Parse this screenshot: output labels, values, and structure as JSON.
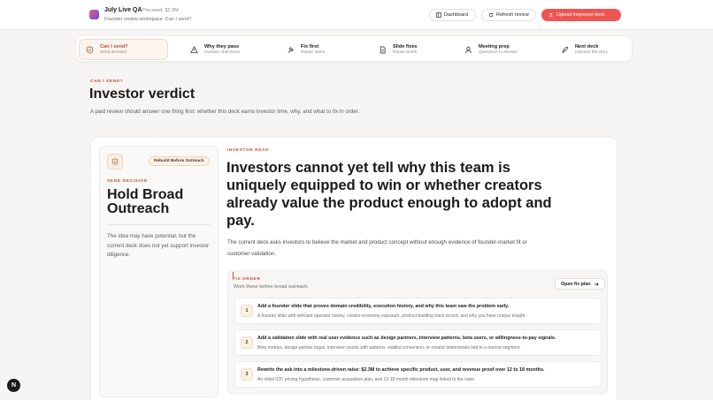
{
  "app": {
    "title": "July Live QA",
    "stage": "Pre-seed, $2.3M",
    "workspace": "Founder review workspace: Can I send?"
  },
  "actions": {
    "dashboard": "Dashboard",
    "refresh": "Refresh review",
    "upload": "Upload improved deck"
  },
  "steps": [
    {
      "label": "Can I send?",
      "sub": "Send decision",
      "icon": "shield-check-icon"
    },
    {
      "label": "Why they pass",
      "sub": "Investor objections",
      "icon": "warning-icon"
    },
    {
      "label": "Fix first",
      "sub": "Repair sprint",
      "icon": "hammer-icon"
    },
    {
      "label": "Slide fixes",
      "sub": "Repair briefs",
      "icon": "document-icon"
    },
    {
      "label": "Meeting prep",
      "sub": "Questions to answer",
      "icon": "person-icon"
    },
    {
      "label": "Next deck",
      "sub": "Improve the story",
      "icon": "rocket-icon"
    }
  ],
  "header": {
    "eyebrow": "CAN I SEND?",
    "title": "Investor verdict",
    "description": "A paid review should answer one thing first: whether this deck earns investor time, why, and what to fix in order."
  },
  "decision": {
    "badge": "Rebuild Before Outreach",
    "label": "SEND DECISION",
    "title": "Hold Broad Outreach",
    "description": "The idea may have potential, but the current deck does not yet support investor diligence."
  },
  "read": {
    "label": "INVESTOR READ",
    "headline": "Investors cannot yet tell why this team is uniquely equipped to win or whether creators already value the product enough to adopt and pay.",
    "summary": "The current deck asks investors to believe the market and product concept without enough evidence of founder-market fit or customer validation."
  },
  "fix_order": {
    "label": "FIX ORDER",
    "sub": "Work these before broad outreach.",
    "open_plan": "Open fix plan",
    "items": [
      {
        "num": "1",
        "title": "Add a founder slide that proves domain credibility, execution history, and why this team saw the problem early.",
        "desc": "A founder slide with relevant operator history, creator-economy exposure, product-building track record, and why you have unique insight."
      },
      {
        "num": "2",
        "title": "Add a validation slide with real user evidence such as design partners, interview patterns, beta users, or willingness-to-pay signals.",
        "desc": "Beta metrics, design-partner logos, interview counts with patterns, waitlist conversion, or creator testimonials tied to a narrow segment."
      },
      {
        "num": "3",
        "title": "Rewrite the ask into a milestone-driven raise: $2.3M to achieve specific product, user, and revenue proof over 12 to 18 months.",
        "desc": "An initial ICP, pricing hypothesis, customer acquisition plan, and 12-18 month milestone map linked to the raise."
      }
    ]
  },
  "misc": {
    "corner_badge": "N"
  }
}
